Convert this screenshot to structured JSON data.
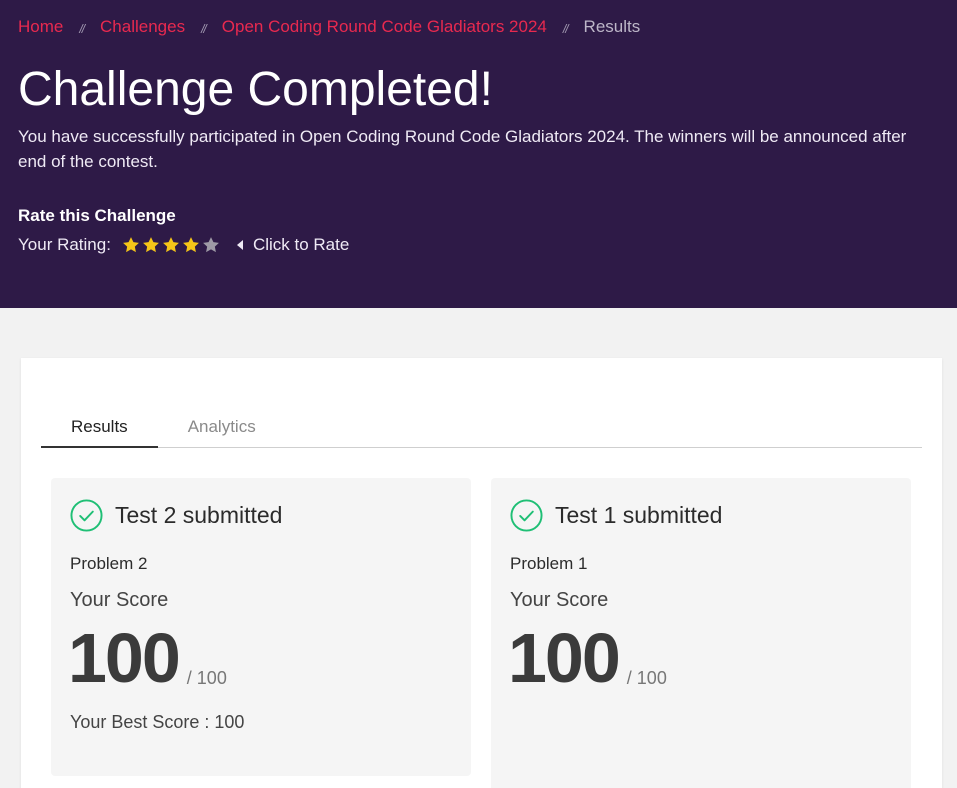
{
  "breadcrumb": {
    "home": "Home",
    "challenges": "Challenges",
    "challenge_name": "Open Coding Round Code Gladiators 2024",
    "current": "Results",
    "separator": "//"
  },
  "header": {
    "title": "Challenge Completed!",
    "description": "You have successfully participated in Open Coding Round Code Gladiators 2024. The winners will be announced after end of the contest."
  },
  "rating": {
    "section_title": "Rate this Challenge",
    "label": "Your Rating:",
    "value": 4,
    "max": 5,
    "action_label": "Click to Rate",
    "filled_color": "#f5c518",
    "empty_color": "#9e9aa6"
  },
  "tabs": [
    {
      "label": "Results",
      "active": true
    },
    {
      "label": "Analytics",
      "active": false
    }
  ],
  "results": [
    {
      "title": "Test 2 submitted",
      "problem": "Problem 2",
      "score_label": "Your Score",
      "score": "100",
      "max_score": "/ 100",
      "best_score": "Your Best Score : 100"
    },
    {
      "title": "Test 1 submitted",
      "problem": "Problem 1",
      "score_label": "Your Score",
      "score": "100",
      "max_score": "/ 100"
    }
  ],
  "colors": {
    "hero_bg": "#2e1a47",
    "link": "#e8294f",
    "success": "#1fbf75"
  },
  "icons": {
    "star": "star-icon",
    "check": "check-circle-icon",
    "caret": "caret-left-icon"
  }
}
